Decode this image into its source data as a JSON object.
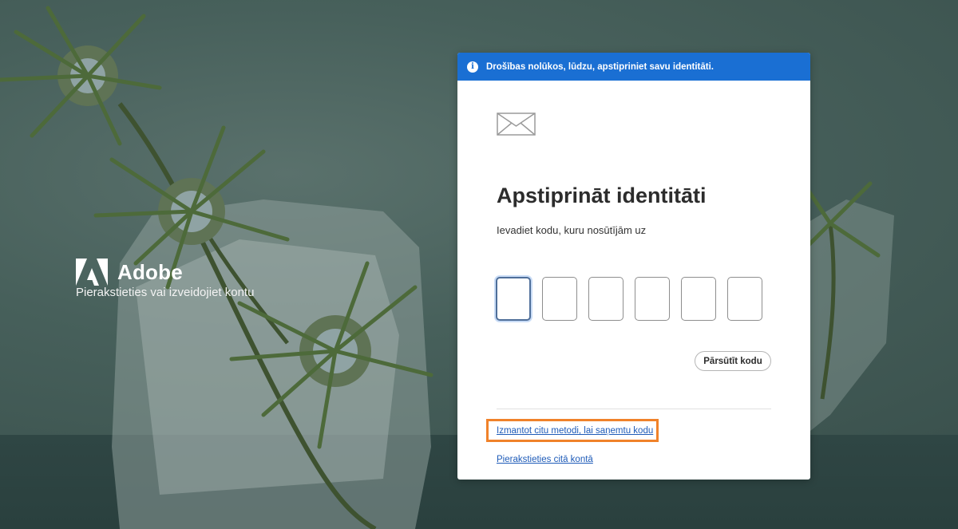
{
  "brand": {
    "name": "Adobe",
    "tagline": "Pierakstieties vai izveidojiet kontu"
  },
  "banner": {
    "icon": "info-icon",
    "text": "Drošības nolūkos, lūdzu, apstipriniet savu identitāti."
  },
  "verify": {
    "icon": "envelope-icon",
    "title": "Apstiprināt identitāti",
    "subtitle": "Ievadiet kodu, kuru nosūtījām uz",
    "code_digits": [
      "",
      "",
      "",
      "",
      "",
      ""
    ],
    "resend_label": "Pārsūtīt kodu",
    "other_method_link": "Izmantot citu metodi, lai saņemtu kodu",
    "other_account_link": "Pierakstieties citā kontā"
  },
  "colors": {
    "banner": "#1a6fd3",
    "link": "#1e5bb8",
    "highlight": "#f0822a",
    "background": "#3e5451"
  }
}
